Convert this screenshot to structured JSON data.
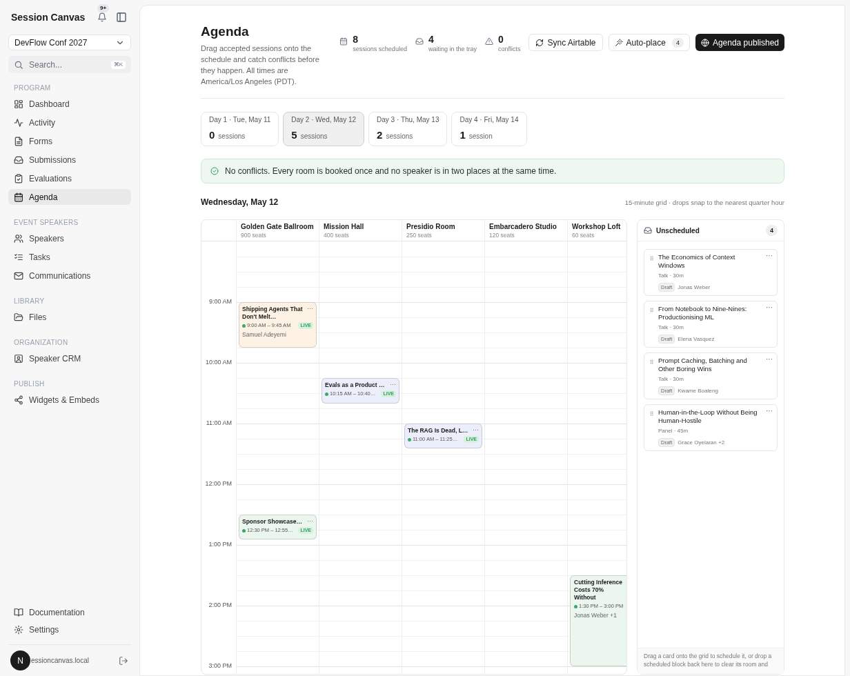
{
  "sidebar": {
    "app_title": "Session Canvas",
    "notifications_badge": "9+",
    "event_select": "DevFlow Conf 2027",
    "search": {
      "placeholder": "Search...",
      "shortcut": "⌘K"
    },
    "sections": [
      {
        "heading": "PROGRAM",
        "items": [
          {
            "label": "Dashboard",
            "selected": false
          },
          {
            "label": "Activity",
            "selected": false
          },
          {
            "label": "Forms",
            "selected": false
          },
          {
            "label": "Submissions",
            "selected": false
          },
          {
            "label": "Evaluations",
            "selected": false
          },
          {
            "label": "Agenda",
            "selected": true
          }
        ]
      },
      {
        "heading": "EVENT SPEAKERS",
        "items": [
          {
            "label": "Speakers",
            "selected": false
          },
          {
            "label": "Tasks",
            "selected": false
          },
          {
            "label": "Communications",
            "selected": false
          }
        ]
      },
      {
        "heading": "LIBRARY",
        "items": [
          {
            "label": "Files",
            "selected": false
          }
        ]
      },
      {
        "heading": "ORGANIZATION",
        "items": [
          {
            "label": "Speaker CRM",
            "selected": false
          }
        ]
      },
      {
        "heading": "PUBLISH",
        "items": [
          {
            "label": "Widgets & Embeds",
            "selected": false
          }
        ]
      }
    ],
    "footer_links": [
      "Documentation",
      "Settings"
    ],
    "user": {
      "avatar": "N",
      "email": "essioncanvas.local"
    }
  },
  "header": {
    "title": "Agenda",
    "description": "Drag accepted sessions onto the schedule and catch conflicts before they happen. All times are America/Los Angeles (PDT).",
    "stats": [
      {
        "value": "8",
        "label": "sessions scheduled"
      },
      {
        "value": "4",
        "label": "waiting in the tray"
      },
      {
        "value": "0",
        "label": "conflicts"
      }
    ],
    "buttons": [
      {
        "kind": "sync",
        "label": "Sync Airtable"
      },
      {
        "kind": "autoplace",
        "label": "Auto-place",
        "count": "4"
      },
      {
        "kind": "published",
        "label": "Agenda published"
      }
    ]
  },
  "days": [
    {
      "label": "Day 1 · Tue, May 11",
      "count": "0",
      "unit": "sessions",
      "selected": false
    },
    {
      "label": "Day 2 · Wed, May 12",
      "count": "5",
      "unit": "sessions",
      "selected": true
    },
    {
      "label": "Day 3 · Thu, May 13",
      "count": "2",
      "unit": "sessions",
      "selected": false
    },
    {
      "label": "Day 4 · Fri, May 14",
      "count": "1",
      "unit": "session",
      "selected": false
    }
  ],
  "banner": "No conflicts. Every room is booked once and no speaker is in two places at the same time.",
  "schedule": {
    "date": "Wednesday, May 12",
    "hint": "15-minute grid · drops snap to the nearest quarter hour",
    "time_labels": [
      "9:00 AM",
      "10:00 AM",
      "11:00 AM",
      "12:00 PM",
      "1:00 PM",
      "2:00 PM",
      "3:00 PM"
    ],
    "rooms": [
      {
        "name": "Golden Gate Ballroom",
        "seats": "900 seats",
        "sessions": [
          {
            "title": "Shipping Agents That Don't Melt…",
            "time": "9:00 AM – 9:45 AM",
            "badge": "LIVE",
            "speaker": "Samuel Adeyemi",
            "color": "#fdf2e4",
            "menu": "···"
          },
          {
            "title": "Sponsor Showcase…",
            "time": "12:30 PM – 12:55…",
            "badge": "LIVE",
            "color": "#eaf6ee",
            "menu": "···"
          }
        ]
      },
      {
        "name": "Mission Hall",
        "seats": "400 seats",
        "sessions": [
          {
            "title": "Evals as a Product …",
            "time": "10:15 AM – 10:40…",
            "badge": "LIVE",
            "color": "#eceffb",
            "menu": "···"
          }
        ]
      },
      {
        "name": "Presidio Room",
        "seats": "250 seats",
        "sessions": [
          {
            "title": "The RAG Is Dead, L…",
            "time": "11:00 AM – 11:25…",
            "badge": "LIVE",
            "color": "#eceffb",
            "menu": "···"
          }
        ]
      },
      {
        "name": "Embarcadero Studio",
        "seats": "120 seats"
      },
      {
        "name": "Workshop Loft",
        "seats": "60 seats",
        "sessions": [
          {
            "title": "Cutting Inference Costs 70% Without",
            "time": "1:30 PM – 3:00 PM",
            "speaker": "Jonas Weber +1",
            "color": "#eaf6ee"
          }
        ]
      }
    ]
  },
  "tray": {
    "title": "Unscheduled",
    "count": "4",
    "cards": [
      {
        "title": "The Economics of Context Windows",
        "meta": "Talk · 30m",
        "status": "Draft",
        "speaker": "Jonas Weber",
        "menu": "···"
      },
      {
        "title": "From Notebook to Nine-Nines: Productionising ML",
        "meta": "Talk · 30m",
        "status": "Draft",
        "speaker": "Elena Vasquez",
        "menu": "···"
      },
      {
        "title": "Prompt Caching, Batching and Other Boring Wins",
        "meta": "Talk · 30m",
        "status": "Draft",
        "speaker": "Kwame Boateng",
        "menu": "···"
      },
      {
        "title": "Human-in-the-Loop Without Being Human-Hostile",
        "meta": "Panel · 45m",
        "status": "Draft",
        "speaker": "Grace Oyelaran +2",
        "menu": "···"
      }
    ],
    "footer": "Drag a card onto the grid to schedule it, or drop a scheduled block back here to clear its room and"
  }
}
